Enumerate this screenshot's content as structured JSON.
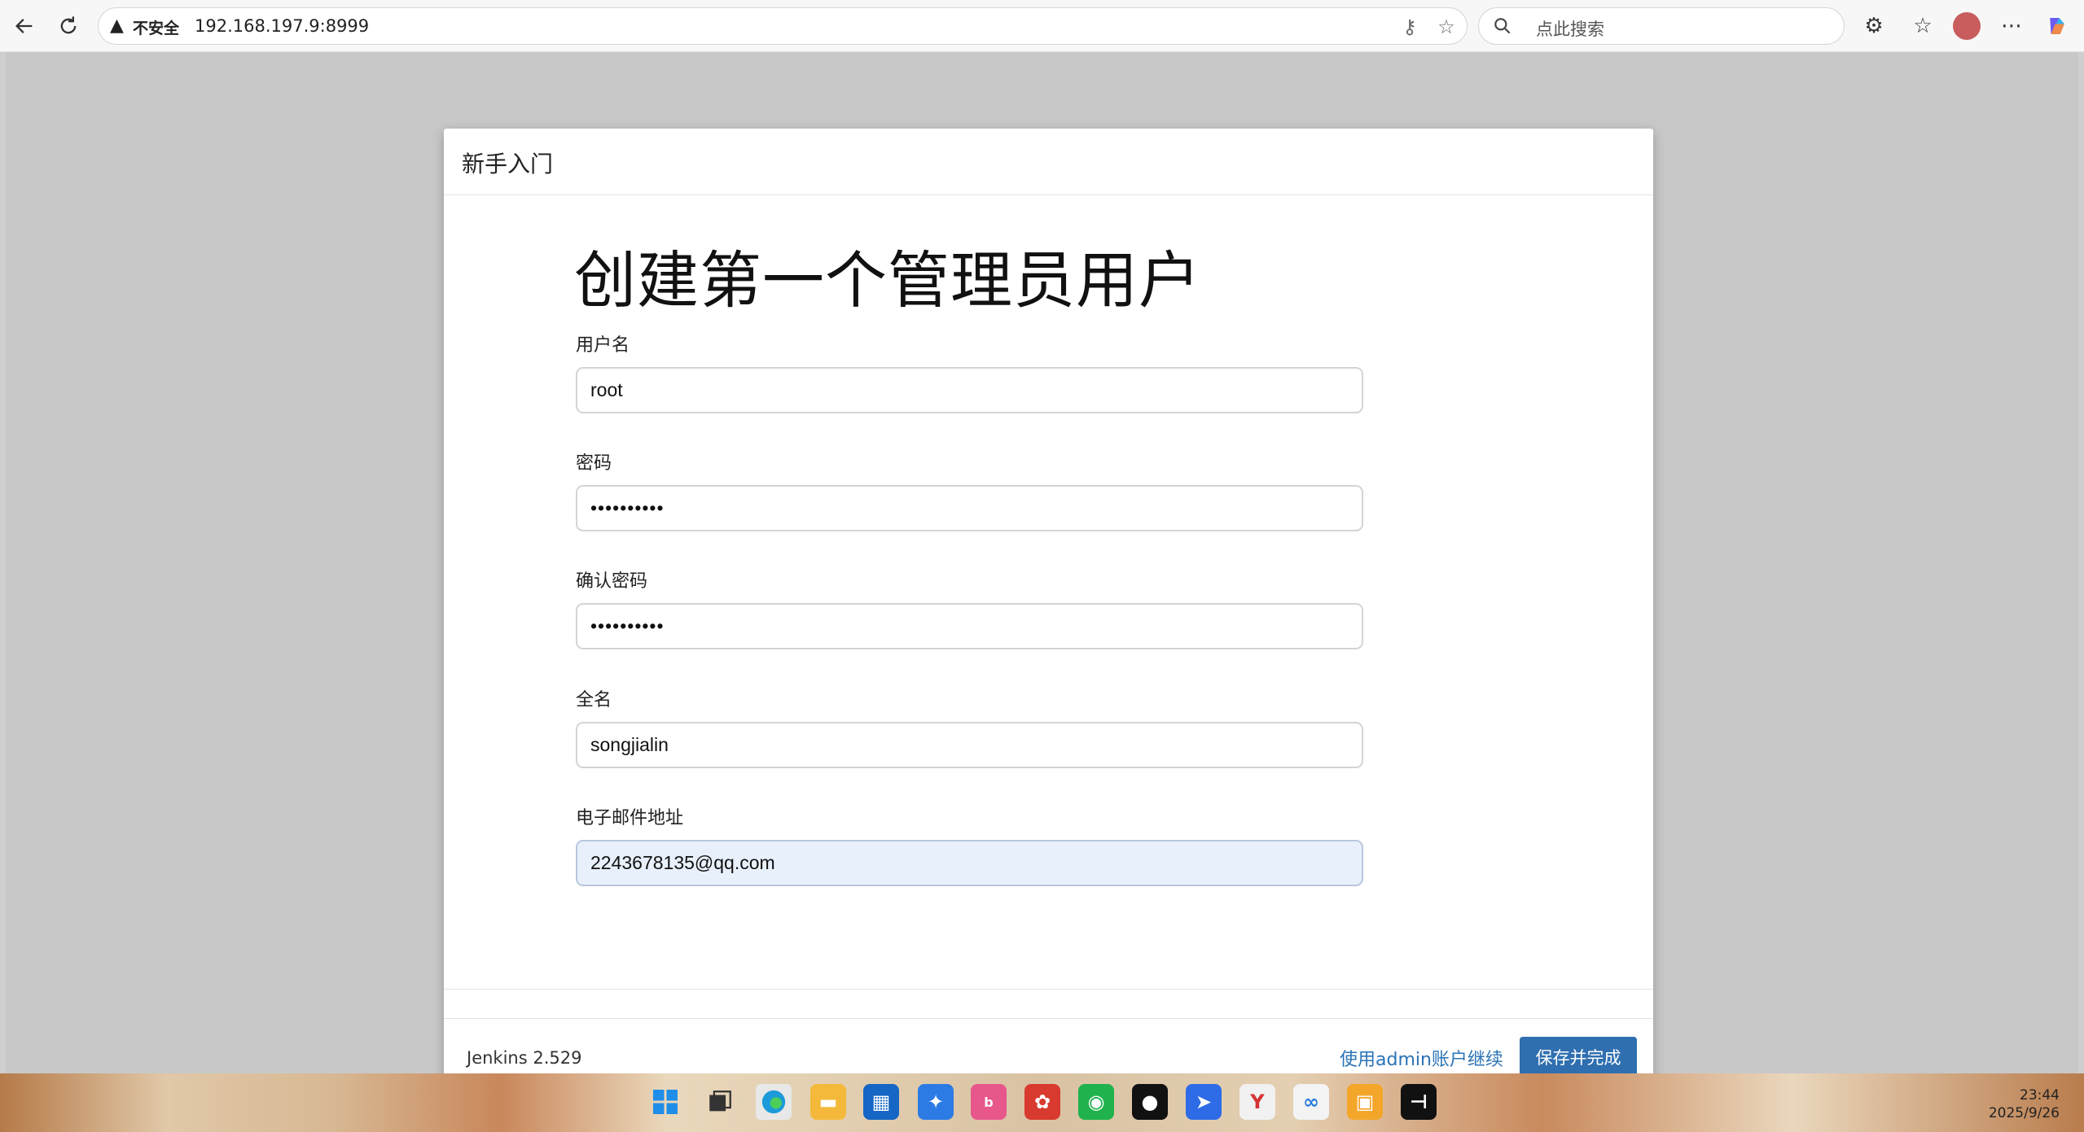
{
  "browser": {
    "security_label": "不安全",
    "url": "192.168.197.9:8999",
    "search_placeholder": "点此搜索"
  },
  "dialog": {
    "title": "新手入门",
    "heading": "创建第一个管理员用户",
    "fields": [
      {
        "label": "用户名",
        "value": "root",
        "type": "text"
      },
      {
        "label": "密码",
        "value": "••••••••••",
        "type": "password"
      },
      {
        "label": "确认密码",
        "value": "••••••••••",
        "type": "password"
      },
      {
        "label": "全名",
        "value": "songjialin",
        "type": "text"
      },
      {
        "label": "电子邮件地址",
        "value": "2243678135@qq.com",
        "type": "text"
      }
    ],
    "version": "Jenkins 2.529",
    "continue_as_admin": "使用admin账户继续",
    "save_finish": "保存并完成"
  },
  "taskbar": {
    "time": "23:44",
    "date": "2025/9/26"
  },
  "colors": {
    "primary": "#2f6fb0",
    "link": "#2a73b6",
    "active_field": "#e8f0fb"
  }
}
